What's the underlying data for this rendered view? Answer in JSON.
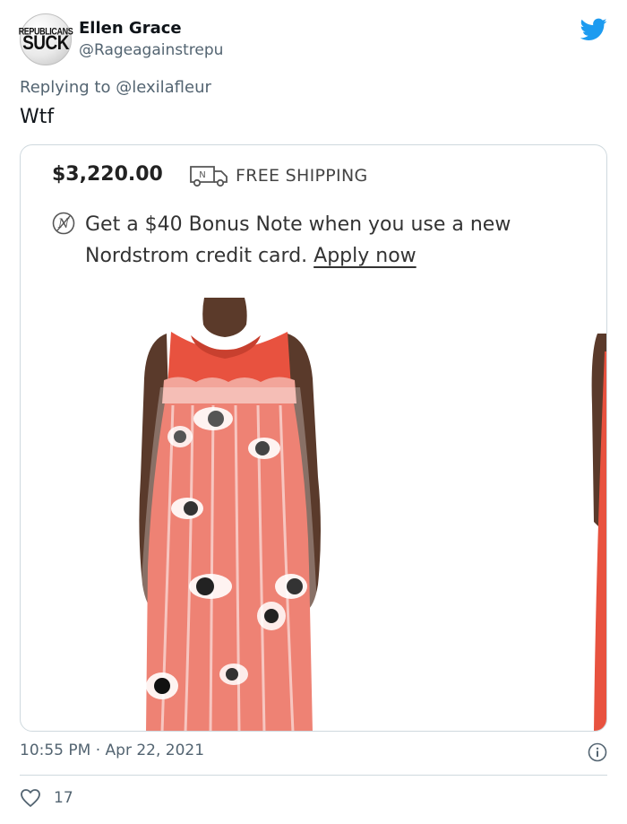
{
  "author": {
    "name": "Ellen Grace",
    "handle": "@Rageagainstrepu",
    "avatar_text_top": "REPUBLICANS",
    "avatar_text_bottom": "SUCK"
  },
  "reply": {
    "prefix": "Replying to",
    "mention": "@lexilafleur"
  },
  "tweet_text": "Wtf",
  "media": {
    "price": "$3,220.00",
    "truck_badge_letter": "N",
    "shipping_label": "FREE SHIPPING",
    "note_icon_letter": "N",
    "note_line1": "Get a $40 Bonus Note when you use a new",
    "note_line2_text": "Nordstrom credit card.",
    "note_link": "Apply now",
    "photo_subject": "model wearing red dress with clear plastic overlay printed with eyes"
  },
  "footer": {
    "timestamp": "10:55 PM · Apr 22, 2021",
    "like_count": "17"
  },
  "colors": {
    "twitter_blue": "#1d9bf0",
    "secondary_text": "#536471",
    "dress_red": "#e8523f",
    "border": "#cfd9de"
  },
  "icons": {
    "brand": "twitter-bird-icon",
    "shipping": "truck-icon",
    "note": "nordstrom-note-icon",
    "info": "info-icon",
    "like": "heart-icon"
  }
}
